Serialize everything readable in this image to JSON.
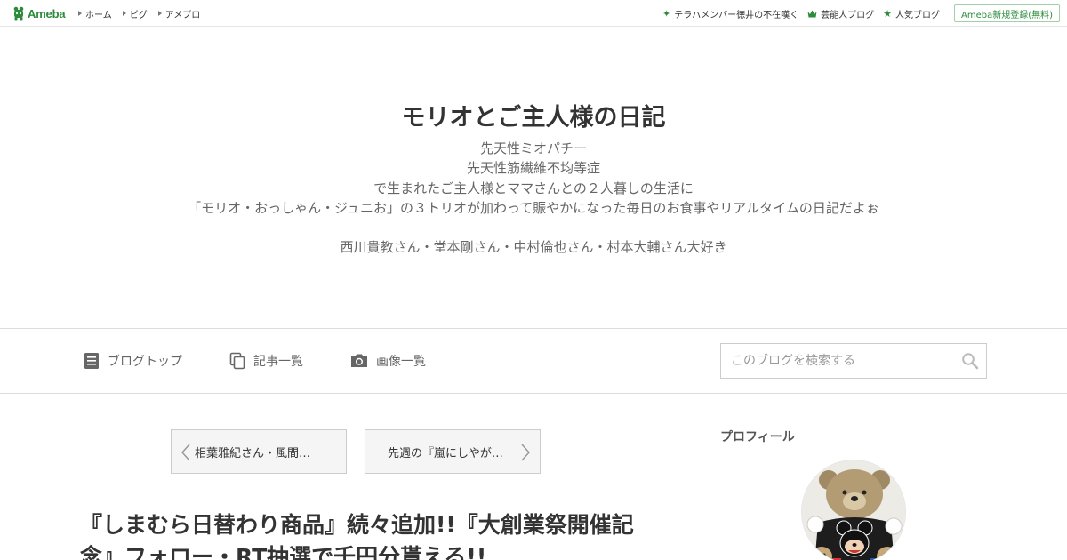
{
  "global_header": {
    "logo_text": "Ameba",
    "nav": [
      {
        "label": "ホーム"
      },
      {
        "label": "ピグ"
      },
      {
        "label": "アメブロ"
      }
    ],
    "right_links": [
      {
        "label": "テラハメンバー徳井の不在嘆く",
        "icon": "sparkle-icon"
      },
      {
        "label": "芸能人ブログ",
        "icon": "crown-icon"
      },
      {
        "label": "人気ブログ",
        "icon": "star-icon"
      }
    ],
    "register_label": "Ameba新規登録(無料)"
  },
  "blog": {
    "title": "モリオとご主人様の日記",
    "description_lines": [
      "先天性ミオパチー",
      "先天性筋繊維不均等症",
      "で生まれたご主人様とママさんとの２人暮しの生活に",
      "「モリオ・おっしゃん・ジュニお」の３トリオが加わって賑やかになった毎日のお食事やリアルタイムの日記だよぉ",
      "",
      "西川貴教さん・堂本剛さん・中村倫也さん・村本大輔さん大好き"
    ]
  },
  "blog_nav": {
    "items": [
      {
        "label": "ブログトップ",
        "icon": "document-icon"
      },
      {
        "label": "記事一覧",
        "icon": "copy-icon"
      },
      {
        "label": "画像一覧",
        "icon": "camera-icon"
      }
    ],
    "search_placeholder": "このブログを検索する"
  },
  "pager": {
    "prev_label": "相葉雅紀さん・風間…",
    "next_label": "先週の『嵐にしやが…"
  },
  "article": {
    "title": "『しまむら日替わり商品』続々追加!!『大創業祭開催記念』フォロー・RT抽選で千円分貰える!!"
  },
  "sidebar": {
    "profile_heading": "プロフィール"
  },
  "colors": {
    "brand": "#2d8c3c",
    "border": "#dddddd",
    "text": "#333333",
    "muted": "#666666"
  }
}
